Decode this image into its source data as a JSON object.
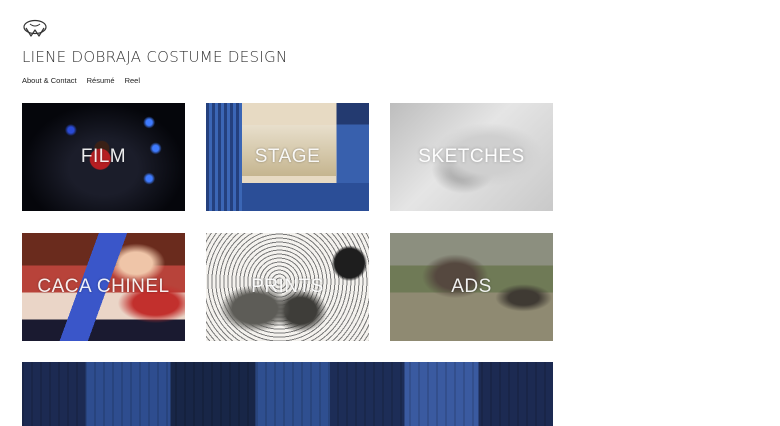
{
  "site": {
    "title": "LIENE DOBRAJA COSTUME DESIGN"
  },
  "nav": {
    "items": [
      {
        "label": "About & Contact"
      },
      {
        "label": "Résumé"
      },
      {
        "label": "Reel"
      }
    ]
  },
  "gallery": {
    "tiles": [
      {
        "label": "FILM"
      },
      {
        "label": "STAGE"
      },
      {
        "label": "SKETCHES"
      },
      {
        "label": "CACA CHINEL"
      },
      {
        "label": "PRINTS"
      },
      {
        "label": "ADS"
      }
    ]
  }
}
